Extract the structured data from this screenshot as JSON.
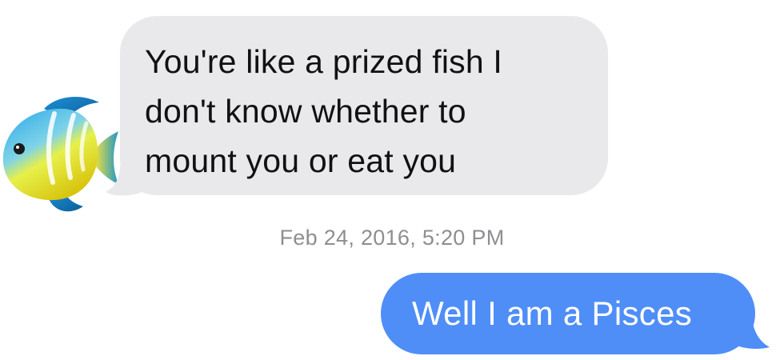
{
  "conversation": {
    "incoming_message": {
      "text": "You're like a prized fish I\ndon't know whether to\nmount you or eat you",
      "avatar_icon": "tropical-fish-icon",
      "bubble_color": "#e9e9eb",
      "text_color": "#111111"
    },
    "timestamp": "Feb 24, 2016, 5:20 PM",
    "outgoing_message": {
      "text": "Well I am a Pisces",
      "bubble_color": "#4f8ef7",
      "text_color": "#ffffff"
    }
  }
}
